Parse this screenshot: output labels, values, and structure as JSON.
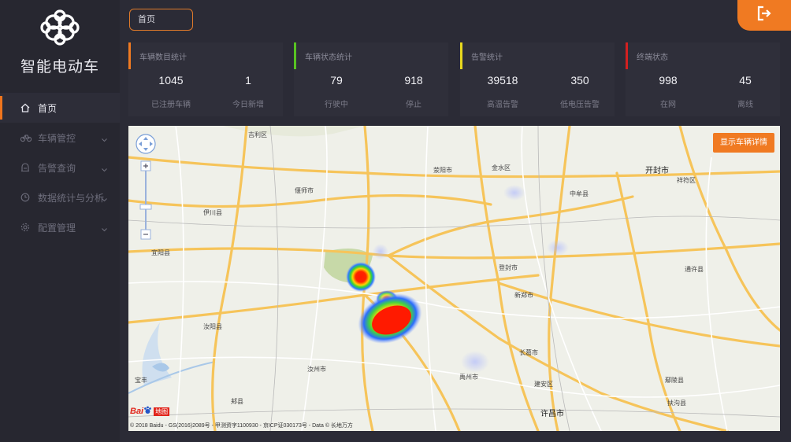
{
  "app": {
    "title": "智能电动车",
    "logo": "china-unicom-knot-logo"
  },
  "sidebar": {
    "items": [
      {
        "label": "首页",
        "icon": "home-icon",
        "active": true
      },
      {
        "label": "车辆管控",
        "icon": "bicycle-icon",
        "active": false
      },
      {
        "label": "告警查询",
        "icon": "alarm-icon",
        "active": false
      },
      {
        "label": "数据统计与分析",
        "icon": "clock-icon",
        "active": false
      },
      {
        "label": "配置管理",
        "icon": "gear-icon",
        "active": false
      }
    ]
  },
  "breadcrumb": {
    "label": "首页"
  },
  "logout": {
    "icon": "logout-icon"
  },
  "cards": [
    {
      "title": "车辆数目统计",
      "accent": "#f07a22",
      "v1": "1045",
      "l1": "已注册车辆",
      "v2": "1",
      "l2": "今日新增"
    },
    {
      "title": "车辆状态统计",
      "accent": "#58c322",
      "v1": "79",
      "l1": "行驶中",
      "v2": "918",
      "l2": "停止"
    },
    {
      "title": "告警统计",
      "accent": "#e8d81e",
      "v1": "39518",
      "l1": "高温告警",
      "v2": "350",
      "l2": "低电压告警"
    },
    {
      "title": "终端状态",
      "accent": "#d42020",
      "v1": "998",
      "l1": "在网",
      "v2": "45",
      "l2": "离线"
    }
  ],
  "map": {
    "detail_button": "显示车辆详情",
    "copyright": "© 2018 Baidu - GS(2016)2089号 - 甲测资字1100930 - 京ICP证030173号 - Data © 长地万方",
    "baidu_logo": {
      "text": "Bai",
      "badge": "地图"
    },
    "labels": [
      "吉利区",
      "荥阳市",
      "金水区",
      "开封市",
      "祥符区",
      "中牟县",
      "偃师市",
      "伊川县",
      "宜阳县",
      "通许县",
      "新郑市",
      "长葛市",
      "禹州市",
      "许昌市",
      "汝州市",
      "鄢陵县",
      "扶沟县",
      "郏县",
      "建安区",
      "宝丰",
      "登封市",
      "汝阳县"
    ]
  }
}
